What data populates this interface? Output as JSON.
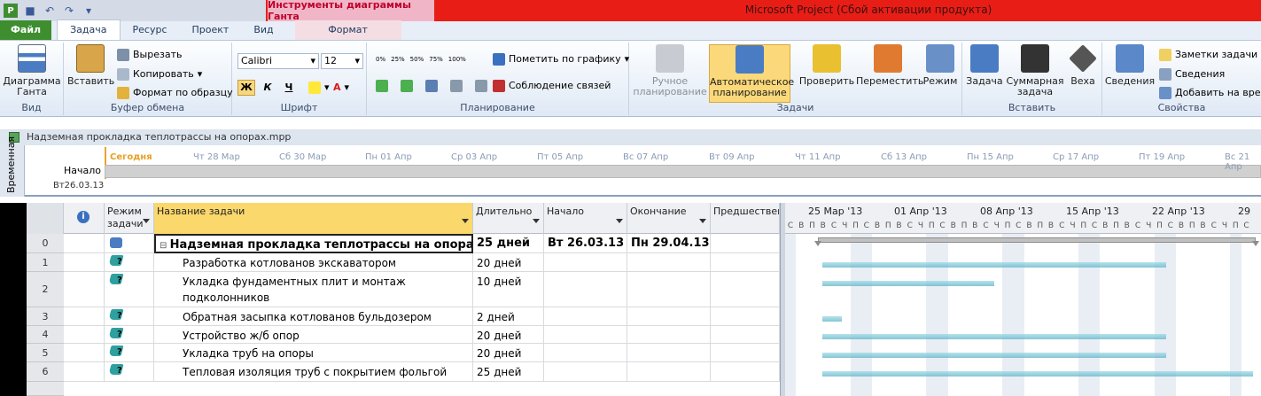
{
  "window": {
    "context_tab": "Инструменты диаграммы Ганта",
    "title": "Microsoft Project (Сбой активации продукта)"
  },
  "tabs": {
    "file": "Файл",
    "task": "Задача",
    "resource": "Ресурс",
    "project": "Проект",
    "view": "Вид",
    "format": "Формат"
  },
  "ribbon": {
    "view_group": {
      "label": "Вид",
      "gantt": "Диаграмма Ганта"
    },
    "clipboard": {
      "label": "Буфер обмена",
      "paste": "Вставить",
      "cut": "Вырезать",
      "copy": "Копировать",
      "format_painter": "Формат по образцу"
    },
    "font": {
      "label": "Шрифт",
      "name": "Calibri",
      "size": "12",
      "bold": "Ж",
      "italic": "К",
      "underline": "Ч"
    },
    "schedule": {
      "label": "Планирование",
      "mark_on_track": "Пометить по графику",
      "respect_links": "Соблюдение связей",
      "pct": [
        "0%",
        "25%",
        "50%",
        "75%",
        "100%"
      ]
    },
    "tasks": {
      "label": "Задачи",
      "manual": "Ручное планирование",
      "auto": "Автоматическое планирование",
      "inspect": "Проверить",
      "move": "Переместить",
      "mode": "Режим"
    },
    "insert": {
      "label": "Вставить",
      "task": "Задача",
      "summary": "Суммарная задача",
      "milestone": "Веха"
    },
    "properties": {
      "label": "Свойства",
      "info": "Сведения",
      "notes": "Заметки задачи",
      "details": "Сведения",
      "add_to_timeline": "Добавить на врем"
    }
  },
  "file": {
    "name": "Надземная прокладка теплотрассы на опорах.mpp"
  },
  "timeline": {
    "side_label": "Временная",
    "start_label": "Начало",
    "start_date": "Вт26.03.13",
    "today": "Сегодня",
    "ticks": [
      "Чт 28 Мар",
      "Сб 30 Мар",
      "Пн 01 Апр",
      "Ср 03 Апр",
      "Пт 05 Апр",
      "Вс 07 Апр",
      "Вт 09 Апр",
      "Чт 11 Апр",
      "Сб 13 Апр",
      "Пн 15 Апр",
      "Ср 17 Апр",
      "Пт 19 Апр",
      "Вс 21 Апр"
    ]
  },
  "grid": {
    "headers": {
      "mode": "Режим задачи",
      "name": "Название задачи",
      "duration": "Длительно",
      "start": "Начало",
      "finish": "Окончание",
      "pred": "Предшествен"
    },
    "rows": [
      {
        "id": "0",
        "name": "Надземная прокладка теплотрассы на опорах",
        "duration": "25 дней",
        "start": "Вт 26.03.13",
        "finish": "Пн 29.04.13"
      },
      {
        "id": "1",
        "name": "Разработка котлованов экскаватором",
        "duration": "20 дней",
        "start": "",
        "finish": ""
      },
      {
        "id": "2",
        "name": "Укладка фундаментных плит и монтаж подколонников",
        "duration": "10 дней",
        "start": "",
        "finish": ""
      },
      {
        "id": "3",
        "name": "Обратная засыпка котлованов бульдозером",
        "duration": "2 дней",
        "start": "",
        "finish": ""
      },
      {
        "id": "4",
        "name": "Устройство ж/б опор",
        "duration": "20 дней",
        "start": "",
        "finish": ""
      },
      {
        "id": "5",
        "name": "Укладка труб на опоры",
        "duration": "20 дней",
        "start": "",
        "finish": ""
      },
      {
        "id": "6",
        "name": "Тепловая изоляция труб с покрытием фольгой",
        "duration": "25 дней",
        "start": "",
        "finish": ""
      }
    ]
  },
  "gantt": {
    "weeks": [
      "25 Мар '13",
      "01 Апр '13",
      "08 Апр '13",
      "15 Апр '13",
      "22 Апр '13",
      "29"
    ],
    "days": [
      "С",
      "В",
      "П",
      "В",
      "С",
      "Ч",
      "П",
      "С",
      "В",
      "П",
      "В",
      "С",
      "Ч",
      "П",
      "С",
      "В",
      "П",
      "В",
      "С",
      "Ч",
      "П",
      "С",
      "В",
      "П",
      "В",
      "С",
      "Ч",
      "П",
      "С",
      "В",
      "П",
      "В",
      "С",
      "Ч",
      "П",
      "С",
      "В",
      "П",
      "В",
      "С",
      "Ч",
      "П",
      "С"
    ]
  }
}
